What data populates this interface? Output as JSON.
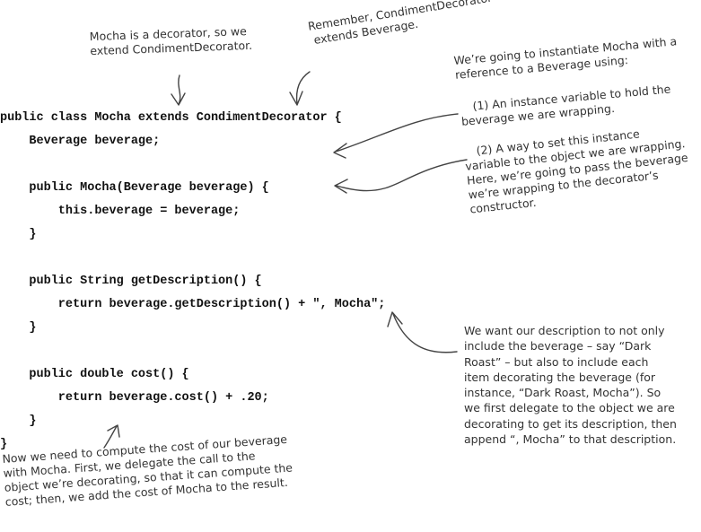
{
  "code": {
    "lines": [
      "public class Mocha extends CondimentDecorator {",
      "    Beverage beverage;",
      "",
      "    public Mocha(Beverage beverage) {",
      "        this.beverage = beverage;",
      "    }",
      "",
      "    public String getDescription() {",
      "        return beverage.getDescription() + \", Mocha\";",
      "    }",
      "",
      "    public double cost() {",
      "        return beverage.cost() + .20;",
      "    }",
      "}"
    ]
  },
  "notes": {
    "decorator": [
      "Mocha is a decorator, so we",
      "extend CondimentDecorator."
    ],
    "remember": [
      "Remember, CondimentDecorator",
      "extends Beverage."
    ],
    "instantiate": [
      "We’re going to instantiate Mocha with a",
      "reference to a Beverage using:"
    ],
    "instance_var": [
      "(1)  An instance variable to hold the",
      "beverage we are wrapping."
    ],
    "setter": [
      "(2)  A way to set this instance",
      "variable to the object we are wrapping.",
      "Here, we’re going to pass the beverage",
      "we’re wrapping to the decorator’s",
      "constructor."
    ],
    "description": [
      "We want our description to not only",
      "include the beverage – say “Dark",
      "Roast” – but also to include each",
      "item decorating the beverage (for",
      "instance, “Dark Roast,  Mocha”). So",
      "we first delegate to the object we are",
      "decorating to get its description, then",
      "append “, Mocha” to that description."
    ],
    "cost": [
      "Now we need to compute the cost of our beverage",
      "with Mocha.  First, we delegate the call to the",
      "object we’re decorating, so that it can compute the",
      "cost; then, we add the cost of Mocha to the result."
    ]
  }
}
